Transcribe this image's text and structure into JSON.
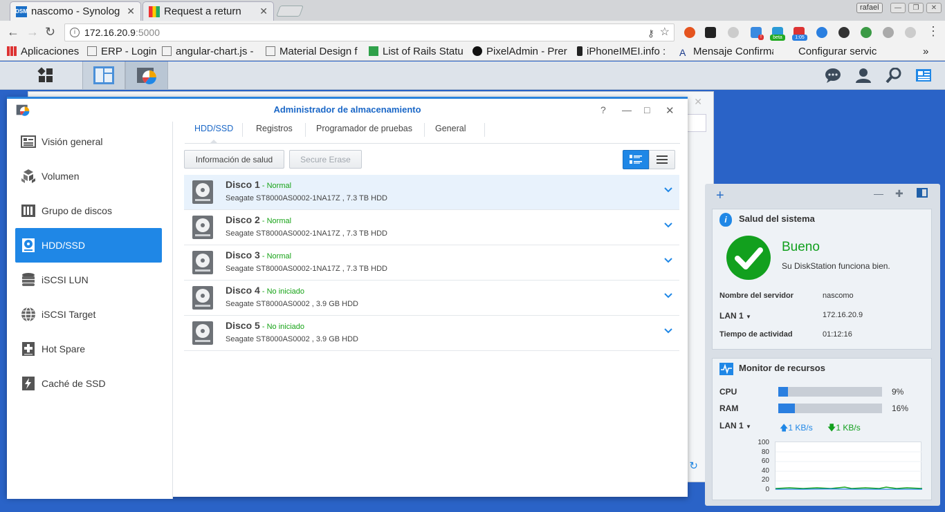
{
  "browser": {
    "tabs": [
      {
        "title": "nascomo - Synolog",
        "favicon_text": "DSM"
      },
      {
        "title": "Request a return"
      }
    ],
    "user_badge": "rafael",
    "url_host": "172.16.20.9",
    "url_port": ":5000",
    "ext_badges": {
      "beta": "beta",
      "time": "1:05",
      "count": "!"
    },
    "bookmarks": [
      "Aplicaciones",
      "ERP - Login",
      "angular-chart.js -",
      "Material Design f",
      "List of Rails Statu",
      "PixelAdmin - Prer",
      "iPhoneIMEI.info :",
      "Mensaje Confirma",
      "Configurar servic"
    ],
    "bookmarks_more": "»"
  },
  "storage_manager": {
    "title": "Administrador de almacenamiento",
    "window_controls": {
      "help": "?",
      "minimize": "—",
      "maximize": "□",
      "close": "✕"
    },
    "sidebar": [
      {
        "label": "Visión general",
        "icon": "overview-icon"
      },
      {
        "label": "Volumen",
        "icon": "volume-icon"
      },
      {
        "label": "Grupo de discos",
        "icon": "disk-group-icon"
      },
      {
        "label": "HDD/SSD",
        "icon": "hdd-icon",
        "active": true
      },
      {
        "label": "iSCSI LUN",
        "icon": "lun-icon"
      },
      {
        "label": "iSCSI Target",
        "icon": "target-icon"
      },
      {
        "label": "Hot Spare",
        "icon": "hot-spare-icon"
      },
      {
        "label": "Caché de SSD",
        "icon": "ssd-cache-icon"
      }
    ],
    "tabs": [
      "HDD/SSD",
      "Registros",
      "Programador de pruebas",
      "General"
    ],
    "buttons": {
      "health": "Información de salud",
      "erase": "Secure Erase"
    },
    "disks": [
      {
        "name": "Disco 1",
        "dash": " - ",
        "status": "Normal",
        "desc": "Seagate ST8000AS0002-1NA17Z , 7.3 TB HDD"
      },
      {
        "name": "Disco 2",
        "dash": " - ",
        "status": "Normal",
        "desc": "Seagate ST8000AS0002-1NA17Z , 7.3 TB HDD"
      },
      {
        "name": "Disco 3",
        "dash": " - ",
        "status": "Normal",
        "desc": "Seagate ST8000AS0002-1NA17Z , 7.3 TB HDD"
      },
      {
        "name": "Disco 4",
        "dash": " - ",
        "status": "No iniciado",
        "desc": "Seagate ST8000AS0002 , 3.9 GB HDD"
      },
      {
        "name": "Disco 5",
        "dash": " - ",
        "status": "No iniciado",
        "desc": "Seagate ST8000AS0002 , 3.9 GB HDD"
      }
    ]
  },
  "widgets": {
    "add": "+",
    "health": {
      "title": "Salud del sistema",
      "status": "Bueno",
      "message": "Su DiskStation funciona bien.",
      "rows": [
        {
          "label": "Nombre del servidor",
          "value": "nascomo"
        },
        {
          "label": "LAN 1",
          "value": "172.16.20.9"
        },
        {
          "label": "Tiempo de actividad",
          "value": "01:12:16"
        }
      ]
    },
    "monitor": {
      "title": "Monitor de recursos",
      "cpu_label": "CPU",
      "cpu_value": "9%",
      "cpu_fraction": 0.09,
      "ram_label": "RAM",
      "ram_value": "16%",
      "ram_fraction": 0.16,
      "lan_label": "LAN 1",
      "upload": "1 KB/s",
      "download": "1 KB/s",
      "y_ticks": [
        "100",
        "80",
        "60",
        "40",
        "20",
        "0"
      ]
    }
  },
  "colors": {
    "accent": "#1f87e6",
    "status_ok": "#17a317",
    "desktop": "#2a63c7"
  }
}
